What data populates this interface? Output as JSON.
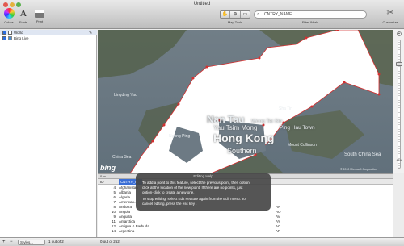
{
  "window": {
    "title": "Untitled"
  },
  "toolbar": {
    "colors_label": "Colors",
    "fonts_label": "Fonts",
    "print_label": "Print",
    "map_tools_label": "Map Tools",
    "filter_label": "Filter World",
    "customize_label": "Customize",
    "search_placeholder": "CNTRY_NAME"
  },
  "layers": [
    {
      "label": "World"
    },
    {
      "label": "Bing Live"
    }
  ],
  "map": {
    "labels": [
      {
        "text": "Lingding Yao"
      },
      {
        "text": "Nan Tau"
      },
      {
        "text": "Yau Tsim Mong"
      },
      {
        "text": "Wong Tai Sin"
      },
      {
        "text": "Sha Tin"
      },
      {
        "text": "Ping Hau Town"
      },
      {
        "text": "Hong Kong"
      },
      {
        "text": "Southern"
      },
      {
        "text": "Mount Collinson"
      },
      {
        "text": "China Sea"
      },
      {
        "text": "South China Sea"
      },
      {
        "text": "Ngong Ping"
      }
    ],
    "bing_logo": "bing",
    "copyright": "© 2010 Microsoft Corporation"
  },
  "tooltip": {
    "title": "Editing Help",
    "line1": "To add a point to this feature, select the previous point, then option-",
    "line2": "click at the location of the new point.  If there are no points, just",
    "line3": "option-click to create a new one.",
    "line4": "To stop editing, select Edit Feature again from the Edit menu.   To",
    "line5": "cancel editing, press the esc key ."
  },
  "table": {
    "headers": {
      "id": "ID",
      "name": "CNTRY_N..."
    },
    "rows": [
      {
        "id": "4",
        "name": "Afghanistan",
        "code": ""
      },
      {
        "id": "5",
        "name": "Albania",
        "code": ""
      },
      {
        "id": "6",
        "name": "Algeria",
        "code": ""
      },
      {
        "id": "7",
        "name": "American...",
        "code": ""
      },
      {
        "id": "8",
        "name": "Andorra",
        "code": "AN"
      },
      {
        "id": "10",
        "name": "Angola",
        "code": "AO"
      },
      {
        "id": "9",
        "name": "Anguilla",
        "code": "AV"
      },
      {
        "id": "11",
        "name": "Antarctica",
        "code": "AY"
      },
      {
        "id": "12",
        "name": "Antigua & Barbuda",
        "code": "AC"
      },
      {
        "id": "14",
        "name": "Argentina",
        "code": "AR"
      }
    ]
  },
  "status": {
    "left": "0 out of 252",
    "right": "1 out of 2",
    "styles_label": "Styles..."
  },
  "scale": {
    "label": "0 m"
  },
  "colors": {
    "selected_header": "#3b6fd6",
    "map_polygon": "#ffffff",
    "map_vertex": "#d43030"
  }
}
